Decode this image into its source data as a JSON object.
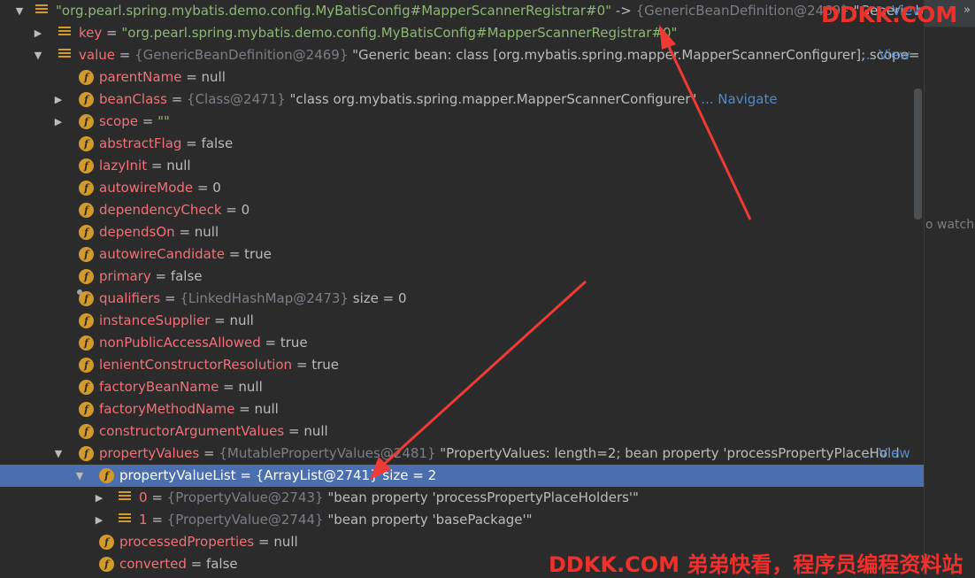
{
  "rows": [
    {
      "arrow": "▼",
      "icon": "entry",
      "indent": 0,
      "name": "\"org.pearl.spring.mybatis.demo.config.MyBatisConfig#MapperScannerRegistrar#0\"",
      "name_style": "str",
      "eq": " -> ",
      "ref": "{GenericBeanDefinition@2469}",
      "val": " \"Generic bean: class [org.mybatis.spring.mapper...",
      "view": "View"
    },
    {
      "arrow": "▶",
      "icon": "entry",
      "indent": 1,
      "name": "key",
      "eq": " = ",
      "val_str": "\"org.pearl.spring.mybatis.demo.config.MyBatisConfig#MapperScannerRegistrar#0\""
    },
    {
      "arrow": "▼",
      "icon": "entry",
      "indent": 1,
      "name": "value",
      "eq": " = ",
      "ref": "{GenericBeanDefinition@2469}",
      "val": " \"Generic bean: class [org.mybatis.spring.mapper.MapperScannerConfigurer]; scope=",
      "view": "... View"
    },
    {
      "arrow": "",
      "icon": "f",
      "indent": 2,
      "name": "parentName",
      "eq": " = ",
      "val": "null"
    },
    {
      "arrow": "▶",
      "icon": "f",
      "indent": 2,
      "name": "beanClass",
      "eq": " = ",
      "ref": "{Class@2471}",
      "val": " \"class org.mybatis.spring.mapper.MapperScannerConfigurer\"",
      "link": " ... Navigate"
    },
    {
      "arrow": "▶",
      "icon": "f",
      "indent": 2,
      "name": "scope",
      "eq": " = ",
      "val_str": "\"\""
    },
    {
      "arrow": "",
      "icon": "f",
      "indent": 2,
      "name": "abstractFlag",
      "eq": " = ",
      "val": "false"
    },
    {
      "arrow": "",
      "icon": "f",
      "indent": 2,
      "name": "lazyInit",
      "eq": " = ",
      "val": "null"
    },
    {
      "arrow": "",
      "icon": "f",
      "indent": 2,
      "name": "autowireMode",
      "eq": " = ",
      "val": "0"
    },
    {
      "arrow": "",
      "icon": "f",
      "indent": 2,
      "name": "dependencyCheck",
      "eq": " = ",
      "val": "0"
    },
    {
      "arrow": "",
      "icon": "f",
      "indent": 2,
      "name": "dependsOn",
      "eq": " = ",
      "val": "null"
    },
    {
      "arrow": "",
      "icon": "f",
      "indent": 2,
      "name": "autowireCandidate",
      "eq": " = ",
      "val": "true"
    },
    {
      "arrow": "",
      "icon": "f",
      "indent": 2,
      "name": "primary",
      "eq": " = ",
      "val": "false"
    },
    {
      "arrow": "",
      "icon": "fpin",
      "indent": 2,
      "name": "qualifiers",
      "eq": " = ",
      "ref": "{LinkedHashMap@2473}",
      "val": "  size = 0"
    },
    {
      "arrow": "",
      "icon": "f",
      "indent": 2,
      "name": "instanceSupplier",
      "eq": " = ",
      "val": "null"
    },
    {
      "arrow": "",
      "icon": "f",
      "indent": 2,
      "name": "nonPublicAccessAllowed",
      "eq": " = ",
      "val": "true"
    },
    {
      "arrow": "",
      "icon": "f",
      "indent": 2,
      "name": "lenientConstructorResolution",
      "eq": " = ",
      "val": "true"
    },
    {
      "arrow": "",
      "icon": "f",
      "indent": 2,
      "name": "factoryBeanName",
      "eq": " = ",
      "val": "null"
    },
    {
      "arrow": "",
      "icon": "f",
      "indent": 2,
      "name": "factoryMethodName",
      "eq": " = ",
      "val": "null"
    },
    {
      "arrow": "",
      "icon": "f",
      "indent": 2,
      "name": "constructorArgumentValues",
      "eq": " = ",
      "val": "null"
    },
    {
      "arrow": "▼",
      "icon": "f",
      "indent": 2,
      "name": "propertyValues",
      "eq": " = ",
      "ref": "{MutablePropertyValues@2481}",
      "val": " \"PropertyValues: length=2; bean property 'processPropertyPlaceHold",
      "view": "... View"
    },
    {
      "arrow": "▼",
      "icon": "f",
      "indent": 3,
      "name": "propertyValueList",
      "eq": " = ",
      "ref": "{ArrayList@2741}",
      "val": "  size = 2",
      "selected": true
    },
    {
      "arrow": "▶",
      "icon": "entry",
      "indent": 4,
      "name": "0",
      "eq": " = ",
      "ref": "{PropertyValue@2743}",
      "val": " \"bean property 'processPropertyPlaceHolders'\""
    },
    {
      "arrow": "▶",
      "icon": "entry",
      "indent": 4,
      "name": "1",
      "eq": " = ",
      "ref": "{PropertyValue@2744}",
      "val": " \"bean property 'basePackage'\""
    },
    {
      "arrow": "",
      "icon": "f",
      "indent": 3,
      "name": "processedProperties",
      "eq": " = ",
      "val": "null"
    },
    {
      "arrow": "",
      "icon": "f",
      "indent": 3,
      "name": "converted",
      "eq": " = ",
      "val": "false"
    }
  ],
  "side_panel": {
    "watches_hint": "o watch",
    "overflow_icon": "»"
  },
  "watermarks": {
    "top": "DDKK.COM",
    "bottom": "DDKK.COM 弟弟快看，程序员编程资料站"
  },
  "colors": {
    "selection": "#4b6eaf",
    "field_name": "#f07178",
    "string": "#8db774",
    "link": "#5689c4",
    "annotation_arrow": "#f03a35"
  }
}
